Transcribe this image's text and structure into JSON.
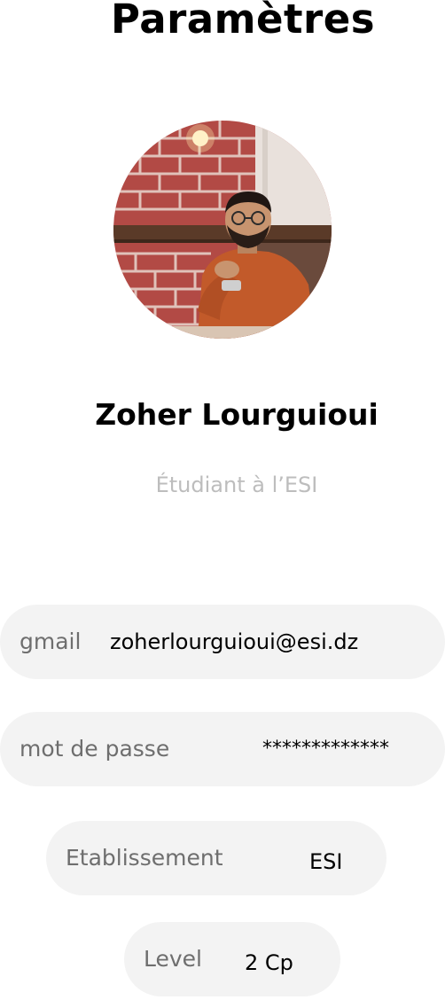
{
  "header": {
    "title": "Paramètres"
  },
  "profile": {
    "name": "Zoher Lourguioui",
    "role": "Étudiant à l’ESI"
  },
  "fields": {
    "gmail": {
      "label": "gmail",
      "value": "zoherlourguioui@esi.dz"
    },
    "password": {
      "label": "mot de passe",
      "value": "*************"
    },
    "establishment": {
      "label": "Etablissement",
      "value": "ESI"
    },
    "level": {
      "label": "Level",
      "value": "2 Cp"
    }
  },
  "colors": {
    "field_bg": "#f3f3f3",
    "label_text": "#6e6e6e",
    "role_text": "#bdbdbd"
  }
}
